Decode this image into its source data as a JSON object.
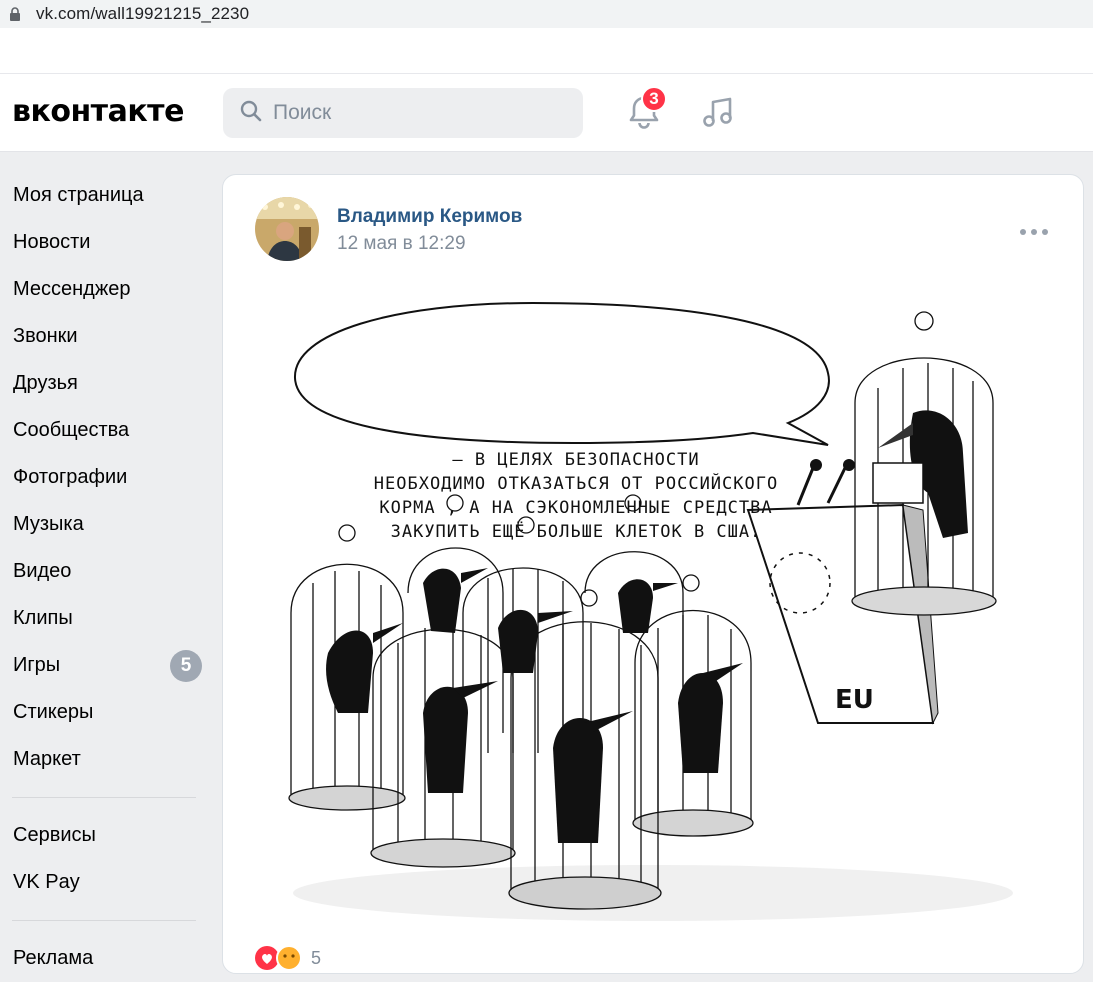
{
  "browser": {
    "url": "vk.com/wall19921215_2230"
  },
  "header": {
    "logo": "вконтакте",
    "search_placeholder": "Поиск",
    "notifications_count": "3"
  },
  "sidebar": {
    "items": [
      {
        "label": "Моя страница"
      },
      {
        "label": "Новости"
      },
      {
        "label": "Мессенджер"
      },
      {
        "label": "Звонки"
      },
      {
        "label": "Друзья"
      },
      {
        "label": "Сообщества"
      },
      {
        "label": "Фотографии"
      },
      {
        "label": "Музыка"
      },
      {
        "label": "Видео"
      },
      {
        "label": "Клипы"
      },
      {
        "label": "Игры",
        "count": "5"
      },
      {
        "label": "Стикеры"
      },
      {
        "label": "Маркет"
      }
    ],
    "secondary": [
      {
        "label": "Сервисы"
      },
      {
        "label": "VK Pay"
      }
    ],
    "tertiary": [
      {
        "label": "Реклама"
      }
    ]
  },
  "post": {
    "author": "Владимир Керимов",
    "date": "12 мая в 12:29",
    "image": {
      "speech_lines": [
        "— В ЦЕЛЯХ БЕЗОПАСНОСТИ",
        "НЕОБХОДИМО ОТКАЗАТЬСЯ ОТ РОССИЙСКОГО",
        "КОРМА , А НА СЭКОНОМЛЕННЫЕ СРЕДСТВА",
        "ЗАКУПИТЬ ЕЩЁ БОЛЬШЕ КЛЕТОК В США."
      ],
      "podium_label": "EU"
    },
    "reactions_count": "5"
  },
  "colors": {
    "vk_link": "#2a5885",
    "badge_red": "#ff3347",
    "muted": "#818c99",
    "bg": "#edeef0"
  }
}
